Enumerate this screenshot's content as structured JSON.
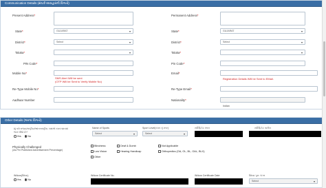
{
  "communication": {
    "header": "Communication Details (સંપર્ક-વ્યવહારની વિગતો)",
    "present_address_label": "Present Address",
    "permanent_address_label": "Permanent Address",
    "state_label": "State",
    "state_value_left": "GUJARAT",
    "state_value_right": "GUJARAT",
    "district_label": "District",
    "district_value_left": "Select",
    "district_value_right": "Select",
    "taluka_label": "Taluka",
    "taluka_value_left": "",
    "taluka_value_right": "",
    "pin_label": "PIN Code",
    "pin_code_label_right": "Pin Code",
    "mobile_label": "Mobile No",
    "email_label": "Email",
    "sms_note_line1": "SMS Alert Will be sent",
    "sms_note_line2": "(OTP Will be Sent to Verify Mobile No)",
    "email_note": "Registration Details Will be Sent to EMail.",
    "retype_mobile_label": "Re-Type Mobile No",
    "retype_email_label": "Re-Type Email",
    "aadhaar_label": "Aadhaar Number",
    "nationality_label": "Nationality",
    "nationality_value": "Indian"
  },
  "other": {
    "header": "Other Details (અન્ય વિગતો)",
    "sports_question": "શું તમે રાજ્ય/રાષ્ટ્રીય/આંતરરાષ્ટ્રીય કક્ષાએ રમતગમતમાં ભાગ લીધો છે?",
    "yes_label": "Yes",
    "no_label": "No",
    "name_of_sports_label": "Name of Sports",
    "name_of_sports_value": "Select",
    "sport_level_label": "Sport Level(રમત નું સ્તર)",
    "sport_level_value": "Select",
    "cert_no_label": "સર્ટિફિકેટ નંબર",
    "cert_date_label": "સર્ટિફિકેટ તારીખ",
    "physically_challenged_label": "Physically Challenged",
    "physically_challenged_sub": "(As Per Published Advertisement Percentage)",
    "pc_options": [
      "Blindness",
      "Deaf & Dumb",
      "Not Applicable",
      "Low Vision",
      "Hearing Handicap",
      "Orthopedics (OA, OL, BL, OAL, BLX)",
      "Other"
    ],
    "widow_label": "Widow(વિધવા)",
    "widow_cert_no_label": "Widow Certificate No.",
    "widow_cert_date_label": "Widow Certificate Date",
    "widow_extra_label": "વિધવા પુનઃ લગ્ન",
    "widow_extra_value": "Select"
  },
  "colors": {
    "header_bg": "#3a6ea5",
    "error_red": "#d21e1e"
  }
}
